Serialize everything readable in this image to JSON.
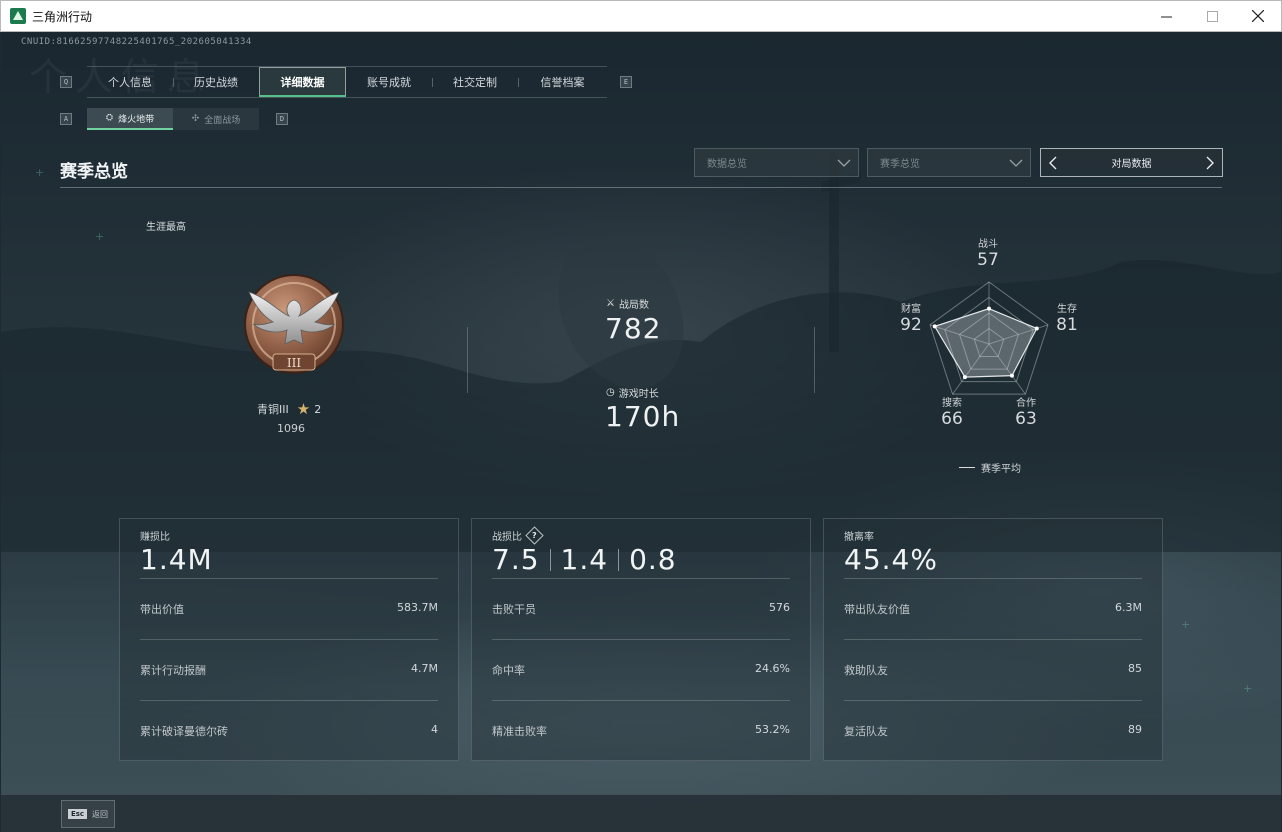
{
  "window": {
    "title": "三角洲行动",
    "minimize": "—",
    "maximize": "☐",
    "close": "✕"
  },
  "header": {
    "cnuid": "CNUID:8166259774822540176​5_202605041334",
    "watermark": "个人信息"
  },
  "key_hints": {
    "left_main": "Q",
    "right_main": "E",
    "left_sub": "A",
    "right_sub": "D"
  },
  "main_tabs": [
    {
      "label": "个人信息",
      "active": false
    },
    {
      "label": "历史战绩",
      "active": false
    },
    {
      "label": "详细数据",
      "active": true
    },
    {
      "label": "账号成就",
      "active": false
    },
    {
      "label": "社交定制",
      "active": false
    },
    {
      "label": "信誉档案",
      "active": false
    }
  ],
  "sub_tabs": [
    {
      "label": "烽火地带",
      "icon": "fire-zone-icon",
      "active": true
    },
    {
      "label": "全面战场",
      "icon": "crosshair-icon",
      "active": false
    }
  ],
  "section_title": "赛季总览",
  "filters": {
    "data_overview": "数据总览",
    "season_overview": "赛季总览",
    "match_data": "对局数据"
  },
  "career": {
    "label": "生涯最高",
    "rank_name": "青铜III",
    "stars": "2",
    "points": "1096",
    "medal_numeral": "III"
  },
  "center_stats": {
    "matches_label": "战局数",
    "matches_value": "782",
    "playtime_label": "游戏时长",
    "playtime_value": "170h"
  },
  "radar": {
    "axes": [
      {
        "label": "战斗",
        "value": 57
      },
      {
        "label": "生存",
        "value": 81
      },
      {
        "label": "合作",
        "value": 63
      },
      {
        "label": "搜索",
        "value": 66
      },
      {
        "label": "财富",
        "value": 92
      }
    ],
    "max": 100,
    "legend": "赛季平均"
  },
  "cards": [
    {
      "title": "赚损比",
      "big_values": [
        "1.4M"
      ],
      "rows": [
        {
          "label": "带出价值",
          "value": "583.7M"
        },
        {
          "label": "累计行动报酬",
          "value": "4.7M"
        },
        {
          "label": "累计破译曼德尔砖",
          "value": "4"
        }
      ]
    },
    {
      "title": "战损比",
      "help": "?",
      "big_values": [
        "7.5",
        "1.4",
        "0.8"
      ],
      "rows": [
        {
          "label": "击败干员",
          "value": "576"
        },
        {
          "label": "命中率",
          "value": "24.6%"
        },
        {
          "label": "精准击败率",
          "value": "53.2%"
        }
      ]
    },
    {
      "title": "撤离率",
      "big_values": [
        "45.4%"
      ],
      "rows": [
        {
          "label": "带出队友价值",
          "value": "6.3M"
        },
        {
          "label": "救助队友",
          "value": "85"
        },
        {
          "label": "复活队友",
          "value": "89"
        }
      ]
    }
  ],
  "footer": {
    "esc_key": "Esc",
    "esc_label": "返回"
  }
}
